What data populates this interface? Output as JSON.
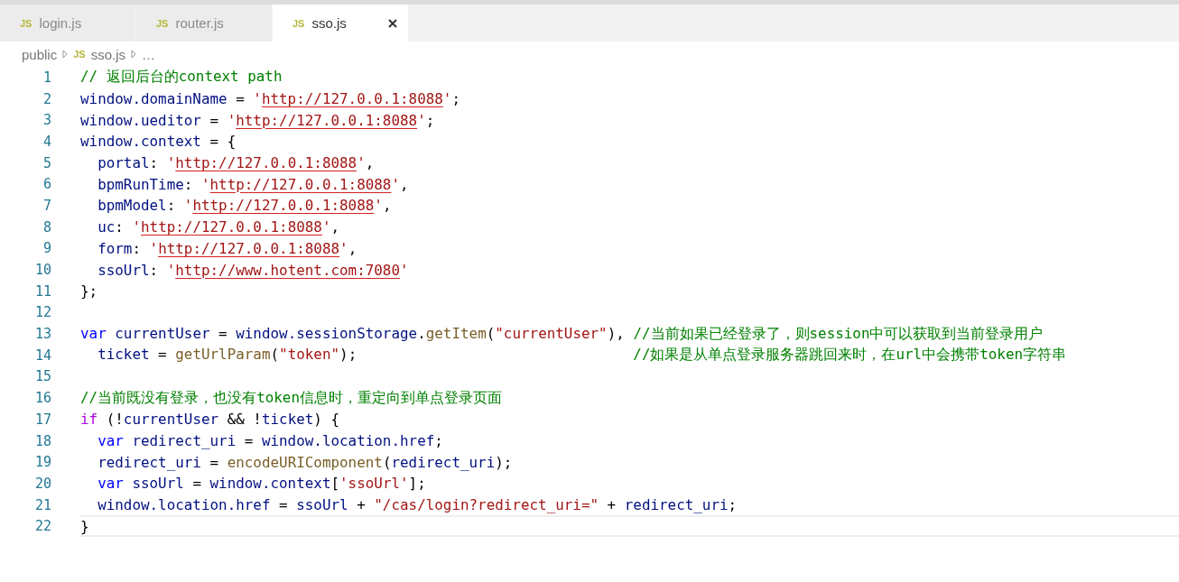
{
  "tabs": [
    {
      "icon": "JS",
      "label": "login.js",
      "selected": false
    },
    {
      "icon": "JS",
      "label": "router.js",
      "selected": false
    },
    {
      "icon": "JS",
      "label": "sso.js",
      "selected": true
    }
  ],
  "breadcrumb": [
    {
      "label": "public"
    },
    {
      "icon": "JS",
      "label": "sso.js"
    },
    {
      "label": "…"
    }
  ],
  "lines": [
    {
      "number": "1",
      "current": false,
      "tokens": [
        {
          "kind": "comment",
          "text": "// 返回后台的context path"
        }
      ]
    },
    {
      "number": "2",
      "current": false,
      "tokens": [
        {
          "kind": "variable",
          "text": "window.domainName"
        },
        {
          "kind": "punct",
          "text": " = "
        },
        {
          "kind": "string",
          "text": "'"
        },
        {
          "kind": "url",
          "text": "http://127.0.0.1:8088"
        },
        {
          "kind": "string",
          "text": "'"
        },
        {
          "kind": "punct",
          "text": ";"
        }
      ]
    },
    {
      "number": "3",
      "current": false,
      "tokens": [
        {
          "kind": "variable",
          "text": "window.ueditor"
        },
        {
          "kind": "punct",
          "text": " = "
        },
        {
          "kind": "string",
          "text": "'"
        },
        {
          "kind": "url",
          "text": "http://127.0.0.1:8088"
        },
        {
          "kind": "string",
          "text": "'"
        },
        {
          "kind": "punct",
          "text": ";"
        }
      ]
    },
    {
      "number": "4",
      "current": false,
      "tokens": [
        {
          "kind": "variable",
          "text": "window.context"
        },
        {
          "kind": "punct",
          "text": " = {"
        }
      ]
    },
    {
      "number": "5",
      "current": false,
      "tokens": [
        {
          "kind": "variable",
          "text": "  portal"
        },
        {
          "kind": "punct",
          "text": ": "
        },
        {
          "kind": "string",
          "text": "'"
        },
        {
          "kind": "url",
          "text": "http://127.0.0.1:8088"
        },
        {
          "kind": "string",
          "text": "'"
        },
        {
          "kind": "punct",
          "text": ","
        }
      ]
    },
    {
      "number": "6",
      "current": false,
      "tokens": [
        {
          "kind": "variable",
          "text": "  bpmRunTime"
        },
        {
          "kind": "punct",
          "text": ": "
        },
        {
          "kind": "string",
          "text": "'"
        },
        {
          "kind": "url",
          "text": "http://127.0.0.1:8088"
        },
        {
          "kind": "string",
          "text": "'"
        },
        {
          "kind": "punct",
          "text": ","
        }
      ]
    },
    {
      "number": "7",
      "current": false,
      "tokens": [
        {
          "kind": "variable",
          "text": "  bpmModel"
        },
        {
          "kind": "punct",
          "text": ": "
        },
        {
          "kind": "string",
          "text": "'"
        },
        {
          "kind": "url",
          "text": "http://127.0.0.1:8088"
        },
        {
          "kind": "string",
          "text": "'"
        },
        {
          "kind": "punct",
          "text": ","
        }
      ]
    },
    {
      "number": "8",
      "current": false,
      "tokens": [
        {
          "kind": "variable",
          "text": "  uc"
        },
        {
          "kind": "punct",
          "text": ": "
        },
        {
          "kind": "string",
          "text": "'"
        },
        {
          "kind": "url",
          "text": "http://127.0.0.1:8088"
        },
        {
          "kind": "string",
          "text": "'"
        },
        {
          "kind": "punct",
          "text": ","
        }
      ]
    },
    {
      "number": "9",
      "current": false,
      "tokens": [
        {
          "kind": "variable",
          "text": "  form"
        },
        {
          "kind": "punct",
          "text": ": "
        },
        {
          "kind": "string",
          "text": "'"
        },
        {
          "kind": "url",
          "text": "http://127.0.0.1:8088"
        },
        {
          "kind": "string",
          "text": "'"
        },
        {
          "kind": "punct",
          "text": ","
        }
      ]
    },
    {
      "number": "10",
      "current": false,
      "tokens": [
        {
          "kind": "variable",
          "text": "  ssoUrl"
        },
        {
          "kind": "punct",
          "text": ": "
        },
        {
          "kind": "string",
          "text": "'"
        },
        {
          "kind": "url",
          "text": "http://www.hotent.com:7080"
        },
        {
          "kind": "string",
          "text": "'"
        }
      ]
    },
    {
      "number": "11",
      "current": false,
      "tokens": [
        {
          "kind": "punct",
          "text": "};"
        }
      ]
    },
    {
      "number": "12"
    },
    {
      "number": "13",
      "current": false,
      "tokens": [
        {
          "kind": "keyword",
          "text": "var "
        },
        {
          "kind": "variable",
          "text": "currentUser"
        },
        {
          "kind": "punct",
          "text": " = "
        },
        {
          "kind": "variable",
          "text": "window.sessionStorage"
        },
        {
          "kind": "punct",
          "text": "."
        },
        {
          "kind": "function",
          "text": "getItem"
        },
        {
          "kind": "punct",
          "text": "("
        },
        {
          "kind": "string",
          "text": "\"currentUser\""
        },
        {
          "kind": "punct",
          "text": "), "
        },
        {
          "kind": "comment",
          "text": "//当前如果已经登录了，则session中可以获取到当前登录用户"
        }
      ]
    },
    {
      "number": "14",
      "current": false,
      "tokens": [
        {
          "kind": "variable",
          "text": "  ticket"
        },
        {
          "kind": "punct",
          "text": " = "
        },
        {
          "kind": "function",
          "text": "getUrlParam"
        },
        {
          "kind": "punct",
          "text": "("
        },
        {
          "kind": "string",
          "text": "\"token\""
        },
        {
          "kind": "punct",
          "text": ");                                "
        },
        {
          "kind": "comment",
          "text": "//如果是从单点登录服务器跳回来时，在url中会携带token字符串"
        }
      ]
    },
    {
      "number": "15"
    },
    {
      "number": "16",
      "current": false,
      "tokens": [
        {
          "kind": "comment",
          "text": "//当前既没有登录，也没有token信息时，重定向到单点登录页面"
        }
      ]
    },
    {
      "number": "17",
      "current": false,
      "tokens": [
        {
          "kind": "control",
          "text": "if"
        },
        {
          "kind": "punct",
          "text": " (!"
        },
        {
          "kind": "variable",
          "text": "currentUser"
        },
        {
          "kind": "punct",
          "text": " && !"
        },
        {
          "kind": "variable",
          "text": "ticket"
        },
        {
          "kind": "punct",
          "text": ") {"
        }
      ]
    },
    {
      "number": "18",
      "current": false,
      "tokens": [
        {
          "kind": "keyword",
          "text": "  var "
        },
        {
          "kind": "variable",
          "text": "redirect_uri"
        },
        {
          "kind": "punct",
          "text": " = "
        },
        {
          "kind": "variable",
          "text": "window.location.href"
        },
        {
          "kind": "punct",
          "text": ";"
        }
      ]
    },
    {
      "number": "19",
      "current": false,
      "tokens": [
        {
          "kind": "variable",
          "text": "  redirect_uri"
        },
        {
          "kind": "punct",
          "text": " = "
        },
        {
          "kind": "function",
          "text": "encodeURIComponent"
        },
        {
          "kind": "punct",
          "text": "("
        },
        {
          "kind": "variable",
          "text": "redirect_uri"
        },
        {
          "kind": "punct",
          "text": ");"
        }
      ]
    },
    {
      "number": "20",
      "current": false,
      "tokens": [
        {
          "kind": "keyword",
          "text": "  var "
        },
        {
          "kind": "variable",
          "text": "ssoUrl"
        },
        {
          "kind": "punct",
          "text": " = "
        },
        {
          "kind": "variable",
          "text": "window.context"
        },
        {
          "kind": "punct",
          "text": "["
        },
        {
          "kind": "string",
          "text": "'ssoUrl'"
        },
        {
          "kind": "punct",
          "text": "];"
        }
      ]
    },
    {
      "number": "21",
      "current": false,
      "tokens": [
        {
          "kind": "variable",
          "text": "  window.location.href"
        },
        {
          "kind": "punct",
          "text": " = "
        },
        {
          "kind": "variable",
          "text": "ssoUrl"
        },
        {
          "kind": "punct",
          "text": " + "
        },
        {
          "kind": "string",
          "text": "\"/cas/login?redirect_uri=\""
        },
        {
          "kind": "punct",
          "text": " + "
        },
        {
          "kind": "variable",
          "text": "redirect_uri"
        },
        {
          "kind": "punct",
          "text": ";"
        }
      ]
    },
    {
      "number": "22",
      "current": true,
      "tokens": [
        {
          "kind": "punct",
          "text": "}"
        }
      ]
    }
  ]
}
